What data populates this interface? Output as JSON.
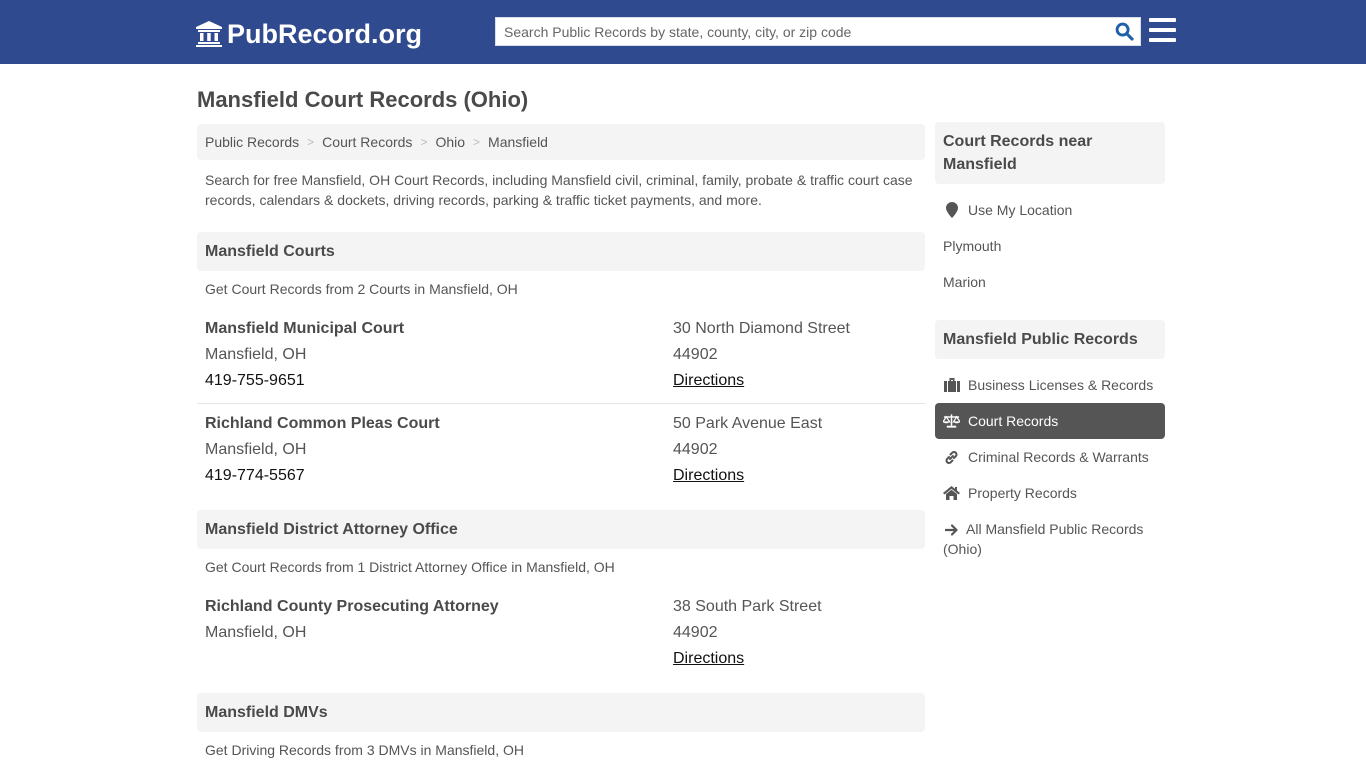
{
  "header": {
    "logo_text": "PubRecord.org",
    "search_placeholder": "Search Public Records by state, county, city, or zip code",
    "search_value": ""
  },
  "page": {
    "title": "Mansfield Court Records (Ohio)",
    "breadcrumb": [
      "Public Records",
      "Court Records",
      "Ohio",
      "Mansfield"
    ],
    "intro": "Search for free Mansfield, OH Court Records, including Mansfield civil, criminal, family, probate & traffic court case records, calendars & dockets, driving records, parking & traffic ticket payments, and more."
  },
  "sections": [
    {
      "title": "Mansfield Courts",
      "subtitle": "Get Court Records from 2 Courts in Mansfield, OH",
      "entries": [
        {
          "name": "Mansfield Municipal Court",
          "city": "Mansfield, OH",
          "phone": "419-755-9651",
          "address": "30 North Diamond Street",
          "zip": "44902",
          "directions": "Directions"
        },
        {
          "name": "Richland Common Pleas Court",
          "city": "Mansfield, OH",
          "phone": "419-774-5567",
          "address": "50 Park Avenue East",
          "zip": "44902",
          "directions": "Directions"
        }
      ]
    },
    {
      "title": "Mansfield District Attorney Office",
      "subtitle": "Get Court Records from 1 District Attorney Office in Mansfield, OH",
      "entries": [
        {
          "name": "Richland County Prosecuting Attorney",
          "city": "Mansfield, OH",
          "address": "38 South Park Street",
          "zip": "44902",
          "directions": "Directions"
        }
      ]
    },
    {
      "title": "Mansfield DMVs",
      "subtitle": "Get Driving Records from 3 DMVs in Mansfield, OH"
    }
  ],
  "sidebar": {
    "nearby": {
      "title": "Court Records near Mansfield",
      "use_location": "Use My Location",
      "places": [
        "Plymouth",
        "Marion"
      ]
    },
    "public_records": {
      "title": "Mansfield Public Records",
      "items": [
        {
          "label": "Business Licenses & Records",
          "icon": "briefcase-icon",
          "active": false
        },
        {
          "label": "Court Records",
          "icon": "scales-icon",
          "active": true
        },
        {
          "label": "Criminal Records & Warrants",
          "icon": "link-icon",
          "active": false
        },
        {
          "label": "Property Records",
          "icon": "home-icon",
          "active": false
        },
        {
          "label": "All Mansfield Public Records (Ohio)",
          "icon": "arrow-right-icon",
          "active": false
        }
      ]
    }
  },
  "colors": {
    "brand": "#2f4a8f",
    "search_icon": "#1d5fa8",
    "active_item": "#555555",
    "panel_bg": "#f4f4f4"
  }
}
